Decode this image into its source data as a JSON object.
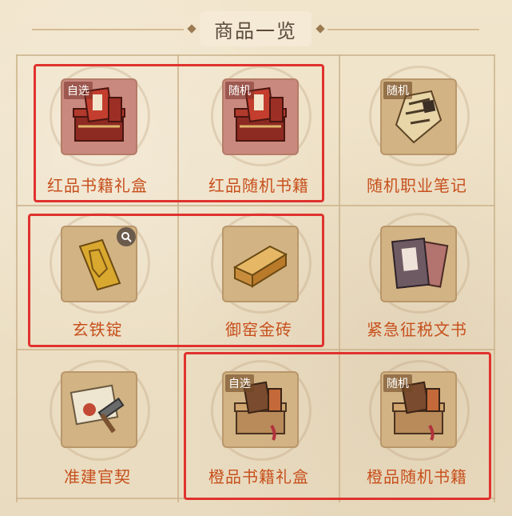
{
  "header": {
    "title": "商品一览"
  },
  "items": [
    {
      "name": "红品书籍礼盒",
      "tag": "自选",
      "frame": "red",
      "icon": "red-book-gift-box-icon"
    },
    {
      "name": "红品随机书籍",
      "tag": "随机",
      "frame": "red",
      "icon": "red-random-book-box-icon"
    },
    {
      "name": "随机职业笔记",
      "tag": "随机",
      "frame": "tan",
      "icon": "scroll-notes-icon"
    },
    {
      "name": "玄铁锭",
      "tag": "",
      "frame": "tan",
      "icon": "iron-ingot-icon"
    },
    {
      "name": "御窑金砖",
      "tag": "",
      "frame": "tan",
      "icon": "gold-brick-icon"
    },
    {
      "name": "紧急征税文书",
      "tag": "",
      "frame": "tan",
      "icon": "tax-document-icon"
    },
    {
      "name": "准建官契",
      "tag": "",
      "frame": "tan",
      "icon": "building-permit-icon"
    },
    {
      "name": "橙品书籍礼盒",
      "tag": "自选",
      "frame": "tan",
      "icon": "orange-book-gift-box-icon"
    },
    {
      "name": "橙品随机书籍",
      "tag": "随机",
      "frame": "tan",
      "icon": "orange-random-book-box-icon"
    }
  ],
  "colors": {
    "label": "#c7501d",
    "highlight": "#e0322e",
    "red_frame": "#c9897e",
    "tan_frame": "#d2b384"
  }
}
